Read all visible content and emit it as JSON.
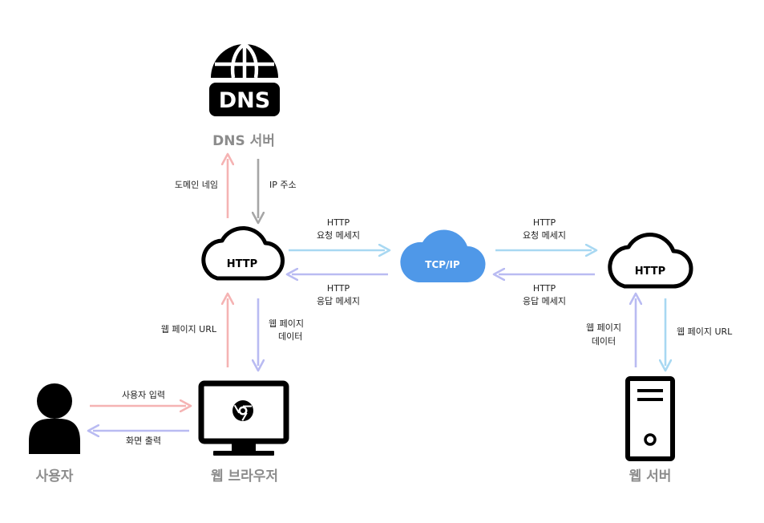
{
  "nodes": {
    "dns": {
      "label": "DNS 서버",
      "icon_text": "DNS"
    },
    "client_cloud": {
      "label": "HTTP"
    },
    "tcpip": {
      "label": "TCP/IP"
    },
    "server_cloud": {
      "label": "HTTP"
    },
    "user": {
      "label": "사용자"
    },
    "browser": {
      "label": "웹 브라우저"
    },
    "web_server": {
      "label": "웹 서버"
    }
  },
  "edges": {
    "domain_name": "도메인 네임",
    "ip_address": "IP 주소",
    "req1_line1": "HTTP",
    "req1_line2": "요청 메세지",
    "resp1_line1": "HTTP",
    "resp1_line2": "응답 메세지",
    "req2_line1": "HTTP",
    "req2_line2": "요청 메세지",
    "resp2_line1": "HTTP",
    "resp2_line2": "응답 메세지",
    "webpage_url_left": "웹 페이지 URL",
    "webpage_data_left_1": "웹 페이지",
    "webpage_data_left_2": "데이터",
    "user_input": "사용자 입력",
    "screen_output": "화면 출력",
    "webpage_data_right_1": "웹 페이지",
    "webpage_data_right_2": "데이터",
    "webpage_url_right": "웹 페이지 URL"
  },
  "colors": {
    "pink_arrow": "#F5B3B3",
    "gray_arrow": "#A6A6A6",
    "light_blue_arrow": "#A8D8F2",
    "lavender_arrow": "#B9BBF2",
    "tcpip_fill": "#4F98E8",
    "node_label": "#8C8C8C",
    "icon": "#000000"
  }
}
